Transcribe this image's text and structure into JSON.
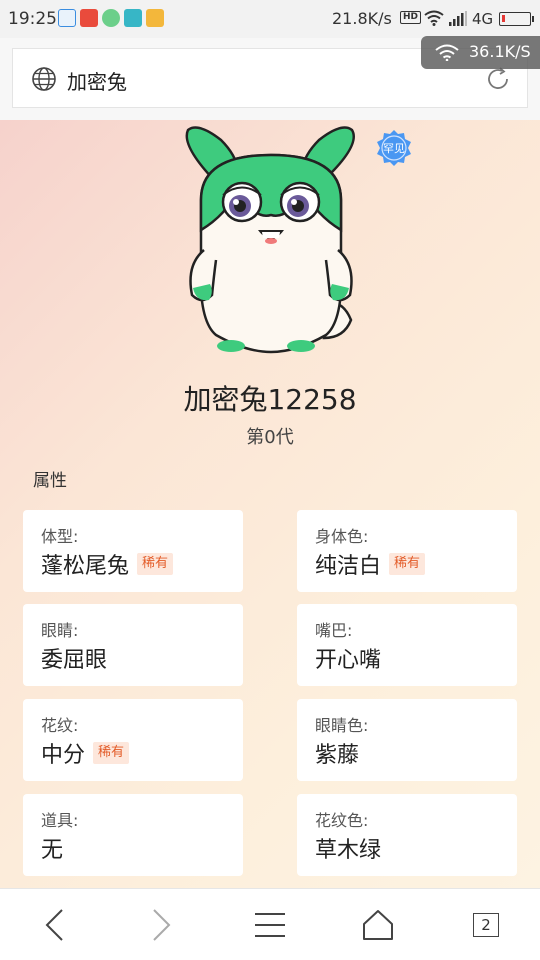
{
  "status_bar": {
    "time": "19:25",
    "net_speed": "21.8K/s",
    "hd": "HD",
    "network": "4G",
    "battery_percent": 10
  },
  "address_bar": {
    "page_title": "加密兔"
  },
  "net_float": {
    "speed": "36.1K/S"
  },
  "pet": {
    "rarity": "罕见",
    "name": "加密兔12258",
    "generation": "第0代",
    "colors": {
      "body": "#3ecb7e",
      "belly": "#fdf8f1",
      "eye": "#6a5a9a"
    }
  },
  "attributes": {
    "title": "属性",
    "items": [
      {
        "label": "体型:",
        "value": "蓬松尾兔",
        "rare": "稀有"
      },
      {
        "label": "身体色:",
        "value": "纯洁白",
        "rare": "稀有"
      },
      {
        "label": "眼睛:",
        "value": "委屈眼",
        "rare": ""
      },
      {
        "label": "嘴巴:",
        "value": "开心嘴",
        "rare": ""
      },
      {
        "label": "花纹:",
        "value": "中分",
        "rare": "稀有"
      },
      {
        "label": "眼睛色:",
        "value": "紫藤",
        "rare": ""
      },
      {
        "label": "道具:",
        "value": "无",
        "rare": ""
      },
      {
        "label": "花纹色:",
        "value": "草木绿",
        "rare": ""
      }
    ]
  },
  "bottom_nav": {
    "tab_count": "2"
  }
}
